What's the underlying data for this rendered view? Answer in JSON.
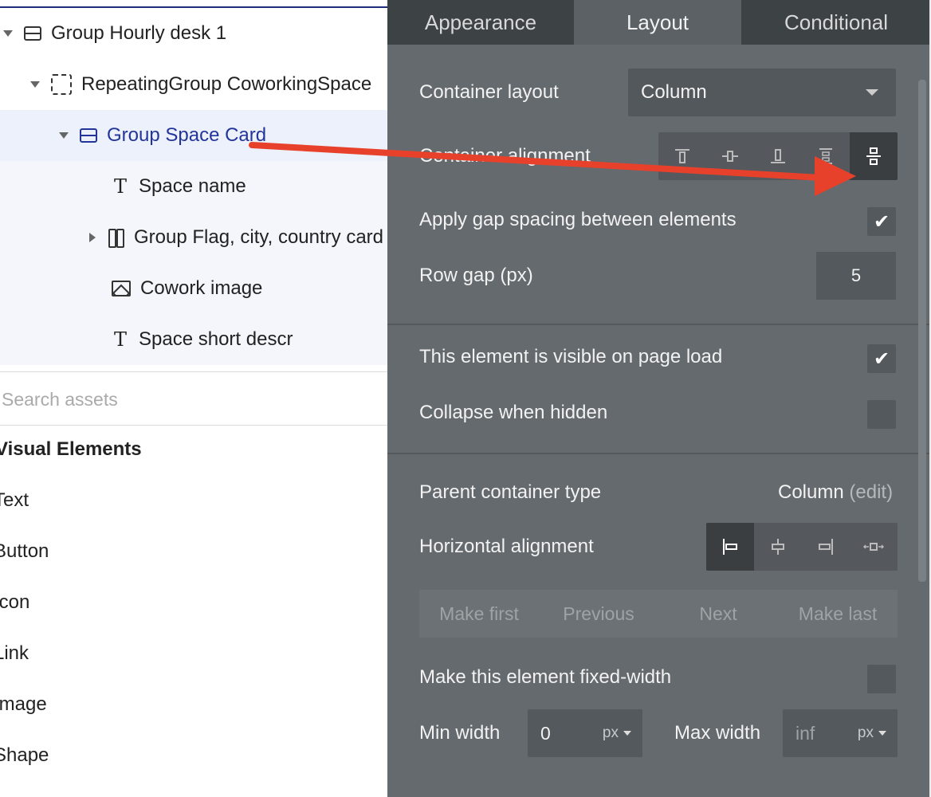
{
  "tree": {
    "items": [
      {
        "label": "Group Hourly desk 1"
      },
      {
        "label": "RepeatingGroup CoworkingSpace"
      },
      {
        "label": "Group Space Card"
      },
      {
        "label": "Space name"
      },
      {
        "label": "Group Flag, city, country card"
      },
      {
        "label": "Cowork image"
      },
      {
        "label": "Space short descr"
      }
    ]
  },
  "assets": {
    "search_placeholder": "Search assets",
    "section_title": "Visual Elements",
    "items": [
      "Text",
      "Button",
      "Icon",
      "Link",
      "Image",
      "Shape"
    ]
  },
  "panel": {
    "tabs": [
      "Appearance",
      "Layout",
      "Conditional"
    ],
    "container_layout_label": "Container layout",
    "container_layout_value": "Column",
    "container_alignment_label": "Container alignment",
    "gap_label": "Apply gap spacing between elements",
    "row_gap_label": "Row gap (px)",
    "row_gap_value": "5",
    "visible_label": "This element is visible on page load",
    "collapse_label": "Collapse when hidden",
    "parent_type_label": "Parent container type",
    "parent_type_value": "Column",
    "parent_type_edit": "(edit)",
    "horizontal_alignment_label": "Horizontal alignment",
    "order": [
      "Make first",
      "Previous",
      "Next",
      "Make last"
    ],
    "fixed_width_label": "Make this element fixed-width",
    "min_width_label": "Min width",
    "min_width_value": "0",
    "min_width_unit": "px",
    "max_width_label": "Max width",
    "max_width_placeholder": "inf",
    "max_width_unit": "px"
  },
  "colors": {
    "panel_bg": "#646a6e",
    "selection_text": "#23359a",
    "arrow": "#e8412b"
  }
}
